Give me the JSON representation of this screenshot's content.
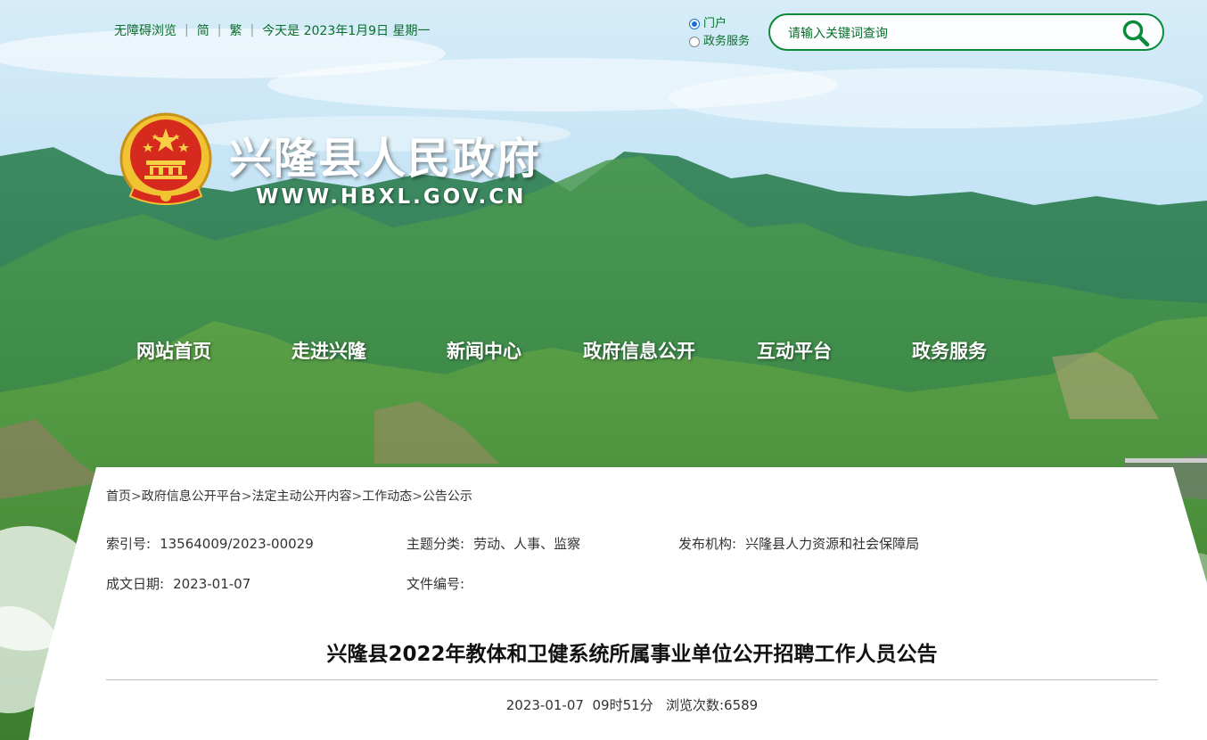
{
  "topbar": {
    "accessibility": "无障碍浏览",
    "simplified": "简",
    "traditional": "繁",
    "date_text": "今天是 2023年1月9日 星期一"
  },
  "search": {
    "scopes": [
      {
        "label": "门户",
        "checked": true
      },
      {
        "label": "政务服务",
        "checked": false
      }
    ],
    "placeholder": "请输入关键词查询",
    "icon": "search-icon",
    "accent_color": "#0a8a3a"
  },
  "header": {
    "title": "兴隆县人民政府",
    "url": "WWW.HBXL.GOV.CN",
    "emblem_icon": "national-emblem-icon"
  },
  "nav": {
    "items": [
      {
        "label": "网站首页"
      },
      {
        "label": "走进兴隆"
      },
      {
        "label": "新闻中心"
      },
      {
        "label": "政府信息公开"
      },
      {
        "label": "互动平台"
      },
      {
        "label": "政务服务"
      }
    ]
  },
  "breadcrumb": {
    "items": [
      "首页",
      "政府信息公开平台",
      "法定主动公开内容",
      "工作动态",
      "公告公示"
    ],
    "separator": ">"
  },
  "meta": {
    "index_label": "索引号:",
    "index_value": "13564009/2023-00029",
    "topic_label": "主题分类:",
    "topic_value": "劳动、人事、监察",
    "publisher_label": "发布机构:",
    "publisher_value": "兴隆县人力资源和社会保障局",
    "date_label": "成文日期:",
    "date_value": "2023-01-07",
    "docno_label": "文件编号:",
    "docno_value": ""
  },
  "article": {
    "title": "兴隆县2022年教体和卫健系统所属事业单位公开招聘工作人员公告",
    "publish_date": "2023-01-07",
    "publish_time": "09时51分",
    "views_label": "浏览次数:",
    "views_value": "6589"
  }
}
